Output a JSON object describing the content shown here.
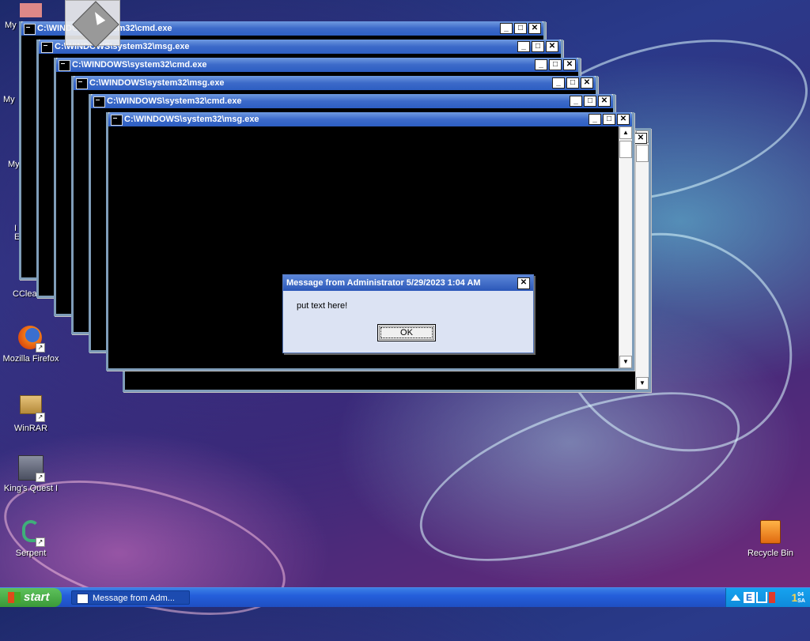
{
  "windows": [
    {
      "title": "C:\\WINDOWS\\system32\\cmd.exe"
    },
    {
      "title": "C:\\WINDOWS\\system32\\msg.exe"
    },
    {
      "title": "C:\\WINDOWS\\system32\\cmd.exe"
    },
    {
      "title": "C:\\WINDOWS\\system32\\msg.exe"
    },
    {
      "title": "C:\\WINDOWS\\system32\\cmd.exe"
    },
    {
      "title": "C:\\WINDOWS\\system32\\msg.exe"
    }
  ],
  "window_buttons": {
    "minimize": "_",
    "maximize": "□",
    "close": "✕"
  },
  "dialog": {
    "title": "Message from Administrator 5/29/2023 1:04 AM",
    "message": "put text here!",
    "ok": "OK",
    "close": "✕"
  },
  "desktop_icons": [
    {
      "label": "My",
      "icon": "my-documents-icon"
    },
    {
      "label": "My",
      "icon": "my-computer-icon"
    },
    {
      "label": "My",
      "icon": "my-network-icon"
    },
    {
      "label": "I\nE",
      "icon": "internet-explorer-icon"
    },
    {
      "label": "CClea",
      "icon": "ccleaner-icon"
    },
    {
      "label": "Mozilla Firefox",
      "icon": "firefox-icon"
    },
    {
      "label": "WinRAR",
      "icon": "winrar-icon"
    },
    {
      "label": "King's Quest I",
      "icon": "kings-quest-icon"
    },
    {
      "label": "Serpent",
      "icon": "serpent-icon"
    },
    {
      "label": "Recycle Bin",
      "icon": "recycle-bin-icon"
    }
  ],
  "taskbar": {
    "start": "start",
    "tasks": [
      {
        "label": "Message from Adm..."
      }
    ],
    "clock": {
      "time": "1",
      "minutes": "04",
      "period": "SA"
    }
  },
  "colors": {
    "titlebar": "#3c6ac9",
    "taskbar": "#245edb",
    "start": "#3a9a38",
    "tray": "#0f8adb",
    "clock": "#ffd54a"
  }
}
